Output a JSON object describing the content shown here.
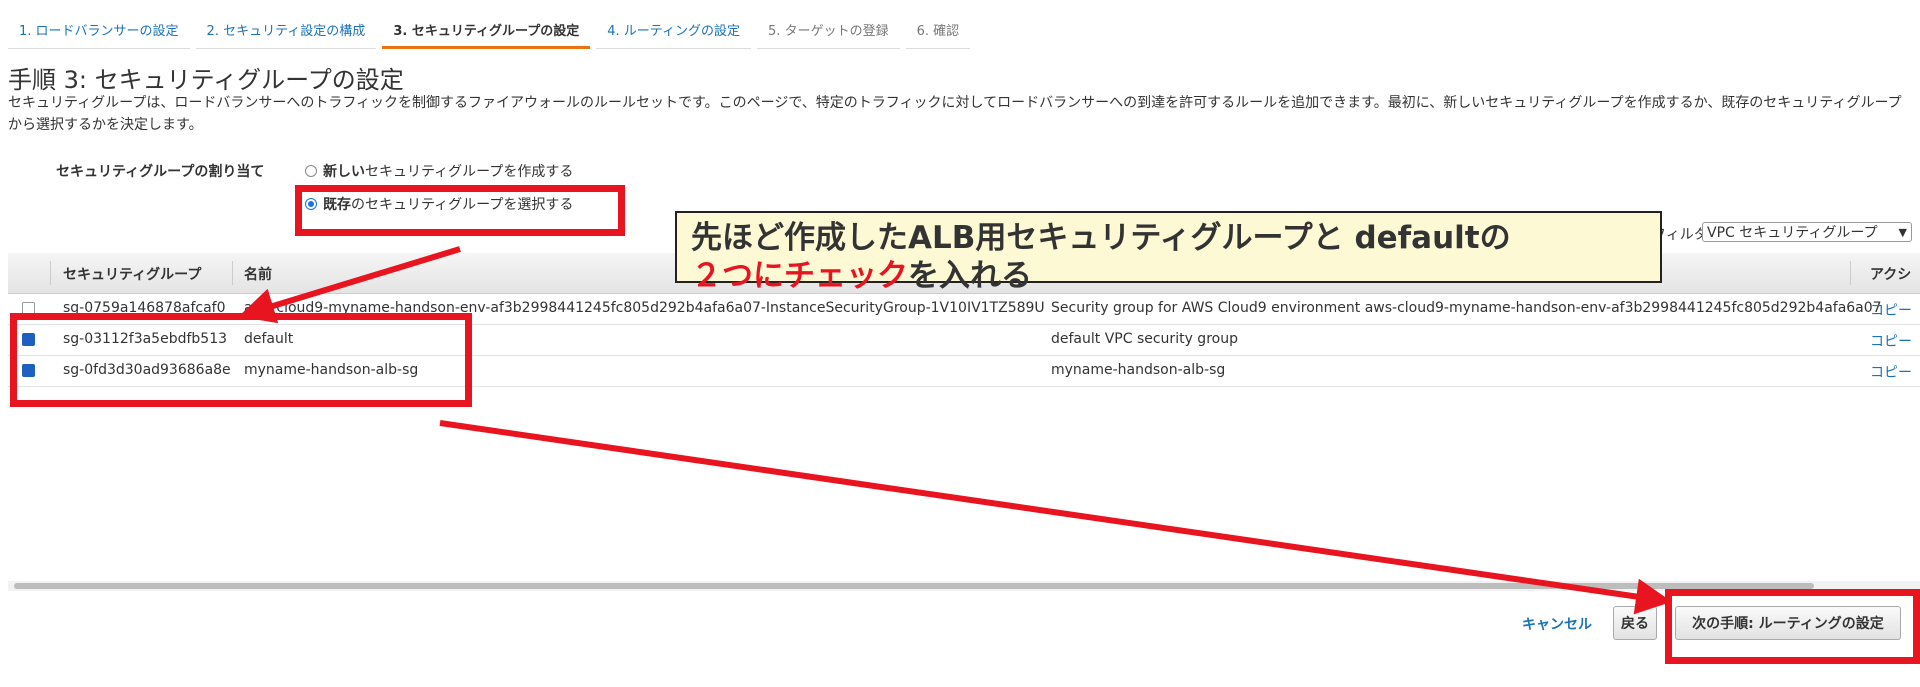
{
  "wizard": {
    "steps": [
      {
        "label": "1. ロードバランサーの設定"
      },
      {
        "label": "2. セキュリティ設定の構成"
      },
      {
        "label": "3. セキュリティグループの設定"
      },
      {
        "label": "4. ルーティングの設定"
      },
      {
        "label": "5. ターゲットの登録"
      },
      {
        "label": "6. 確認"
      }
    ]
  },
  "page": {
    "title": "手順 3: セキュリティグループの設定",
    "description": "セキュリティグループは、ロードバランサーへのトラフィックを制御するファイアウォールのルールセットです。このページで、特定のトラフィックに対してロードバランサーへの到達を許可するルールを追加できます。最初に、新しいセキュリティグループを作成するか、既存のセキュリティグループから選択するかを決定します。"
  },
  "assignment": {
    "label": "セキュリティグループの割り当て",
    "option_new_bold": "新しい",
    "option_new_rest": "セキュリティグループを作成する",
    "option_existing_bold": "既存",
    "option_existing_rest": "のセキュリティグループを選択する",
    "selected": "existing"
  },
  "filter": {
    "label": "フィルタ",
    "selected": "VPC セキュリティグループ"
  },
  "table": {
    "headers": {
      "sg": "セキュリティグループ",
      "name": "名前",
      "actions": "アクシ"
    },
    "rows": [
      {
        "id": "sg-0759a146878afcaf0",
        "name": "aws-cloud9-myname-handson-env-af3b2998441245fc805d292b4afa6a07-InstanceSecurityGroup-1V10IV1TZ589U",
        "desc": "Security group for AWS Cloud9 environment aws-cloud9-myname-handson-env-af3b2998441245fc805d292b4afa6a07",
        "action": "コピー",
        "checked": false
      },
      {
        "id": "sg-03112f3a5ebdfb513",
        "name": "default",
        "desc": "default VPC security group",
        "action": "コピー",
        "checked": true
      },
      {
        "id": "sg-0fd3d30ad93686a8e",
        "name": "myname-handson-alb-sg",
        "desc": "myname-handson-alb-sg",
        "action": "コピー",
        "checked": true
      }
    ]
  },
  "footer": {
    "cancel": "キャンセル",
    "back": "戻る",
    "next": "次の手順: ルーティングの設定"
  },
  "annotation": {
    "line1": "先ほど作成したALB用セキュリティグループと defaultの",
    "line2_red": "２つにチェック",
    "line2_rest": "を入れる"
  },
  "colors": {
    "annotation_red": "#e8141f",
    "callout_bg": "#fdf9d4",
    "link_blue": "#1a73b9",
    "active_tab_orange": "#ec7211"
  }
}
